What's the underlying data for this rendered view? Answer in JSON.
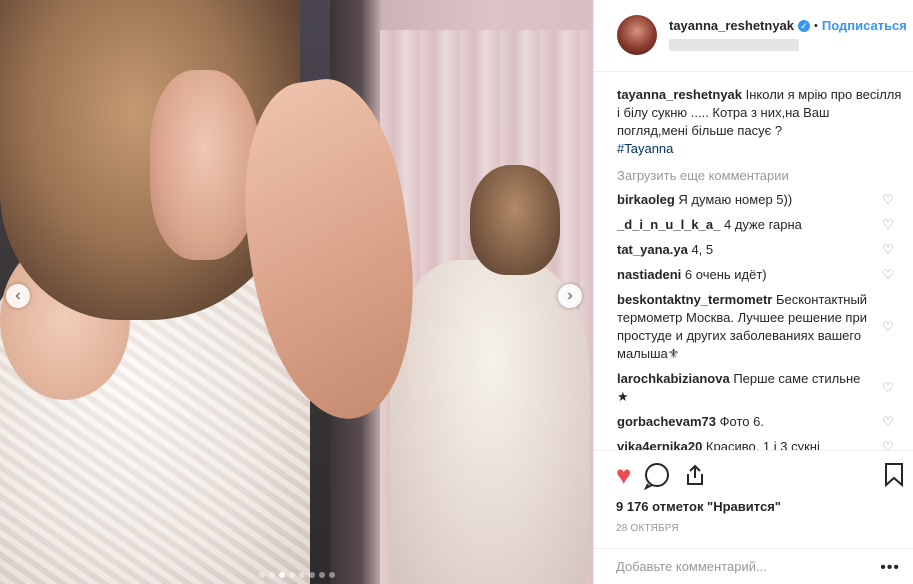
{
  "post": {
    "username": "tayanna_reshetnyak",
    "verified_glyph": "✓",
    "separator": "•",
    "follow_label": "Подписаться",
    "caption_user": "tayanna_reshetnyak",
    "caption_text": " Інколи я мрію про весілля і білу сукню ..... Котра з них,на Ваш погляд,мені більше пасує ?",
    "hashtag": "#Tayanna",
    "load_more_label": "Загрузить еще комментарии",
    "likes_text": "9 176 отметок \"Нравится\"",
    "date_text": "28 октября",
    "add_comment_placeholder": "Добавьте комментарий...",
    "more_glyph": "•••"
  },
  "comments": [
    {
      "user": "birkaoleg",
      "text": " Я думаю номер 5))"
    },
    {
      "user": "_d_i_n_u_l_k_a_",
      "text": " 4 дуже гарна"
    },
    {
      "user": "tat_yana.ya",
      "text": " 4, 5"
    },
    {
      "user": "nastiadeni",
      "text": " 6 очень идёт)"
    },
    {
      "user": "beskontaktny_termometr",
      "text": " Бесконтактный термометр Москва. Лучшее решение при простуде и других заболеваниях вашего малыша⚜"
    },
    {
      "user": "larochkabizianova",
      "text": " Перше саме стильне ★"
    },
    {
      "user": "gorbachevam73",
      "text": " Фото 6."
    },
    {
      "user": "vika4ernika20",
      "text": " Красиво, 1 і 3 сукні"
    }
  ],
  "icons": {
    "heart_small": "♡",
    "like": "♥",
    "prev": "‹",
    "next": "›"
  },
  "carousel": {
    "total": 8,
    "active_index": 2
  },
  "colors": {
    "accent": "#3897f0",
    "like": "#ed4956",
    "muted": "#999999",
    "text": "#262626"
  }
}
